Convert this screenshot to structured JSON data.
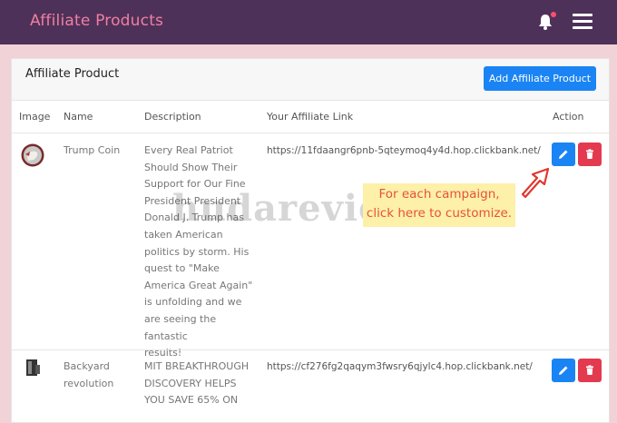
{
  "app": {
    "title": "Affiliate Products"
  },
  "card": {
    "title": "Affiliate Product",
    "add_button": "Add Affiliate Product"
  },
  "table": {
    "headers": [
      "Image",
      "Name",
      "Description",
      "Your Affiliate Link",
      "Action"
    ],
    "rows": [
      {
        "name": "Trump Coin",
        "description_lines": [
          "Every Real Patriot",
          "Should Show Their",
          "Support for Our Fine",
          "President President",
          "Donald J. Trump has",
          "taken American",
          "politics by storm. His",
          "quest to \"Make",
          "America Great Again\"",
          "is unfolding and we",
          "are seeing the fantastic",
          "results!"
        ],
        "link": "https://11fdaangr6pnb-5qteymoq4y4d.hop.clickbank.net/"
      },
      {
        "name_lines": [
          "Backyard",
          "revolution"
        ],
        "description_lines": [
          "MIT BREAKTHROUGH",
          "DISCOVERY HELPS",
          "YOU SAVE 65% ON"
        ],
        "link": "https://cf276fg2qaqym3fwsry6qjylc4.hop.clickbank.net/"
      }
    ]
  },
  "callout": {
    "lines": [
      "For each campaign,",
      "click here to customize."
    ]
  },
  "watermark": "hudareview.com",
  "colors": {
    "topbar": "#4e3159",
    "brand": "#f07fa1",
    "primary": "#1a84f4",
    "danger": "#e33a4f",
    "callout_bg": "#fdf0a8",
    "callout_text": "#e8513a"
  },
  "icons": {
    "notification": "bell-icon",
    "menu": "hamburger-icon",
    "edit": "pencil-icon",
    "delete": "trash-icon"
  }
}
